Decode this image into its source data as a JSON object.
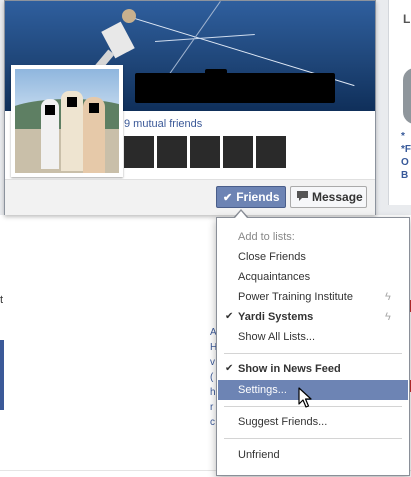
{
  "hovercard": {
    "mutual_friends": "9 mutual friends",
    "friends_button": "Friends",
    "message_button": "Message"
  },
  "friends_menu": {
    "header": "Add to lists:",
    "items": [
      {
        "label": "Close Friends",
        "checked": false
      },
      {
        "label": "Acquaintances",
        "checked": false
      },
      {
        "label": "Power Training Institute",
        "checked": false
      },
      {
        "label": "Yardi Systems",
        "checked": true
      },
      {
        "label": "Show All Lists...",
        "checked": false
      }
    ],
    "news_feed": "Show in News Feed",
    "settings": "Settings...",
    "suggest": "Suggest Friends...",
    "unfriend": "Unfriend"
  },
  "background": {
    "right_card_title": "Li",
    "right_card_lines": [
      "*",
      "*F",
      "O",
      "B"
    ],
    "left_letter": "t",
    "mid_letters": [
      "A",
      "H",
      "v",
      "(",
      "h",
      "r",
      "c"
    ]
  },
  "colors": {
    "accent": "#6d84b4",
    "link": "#3b5998"
  }
}
